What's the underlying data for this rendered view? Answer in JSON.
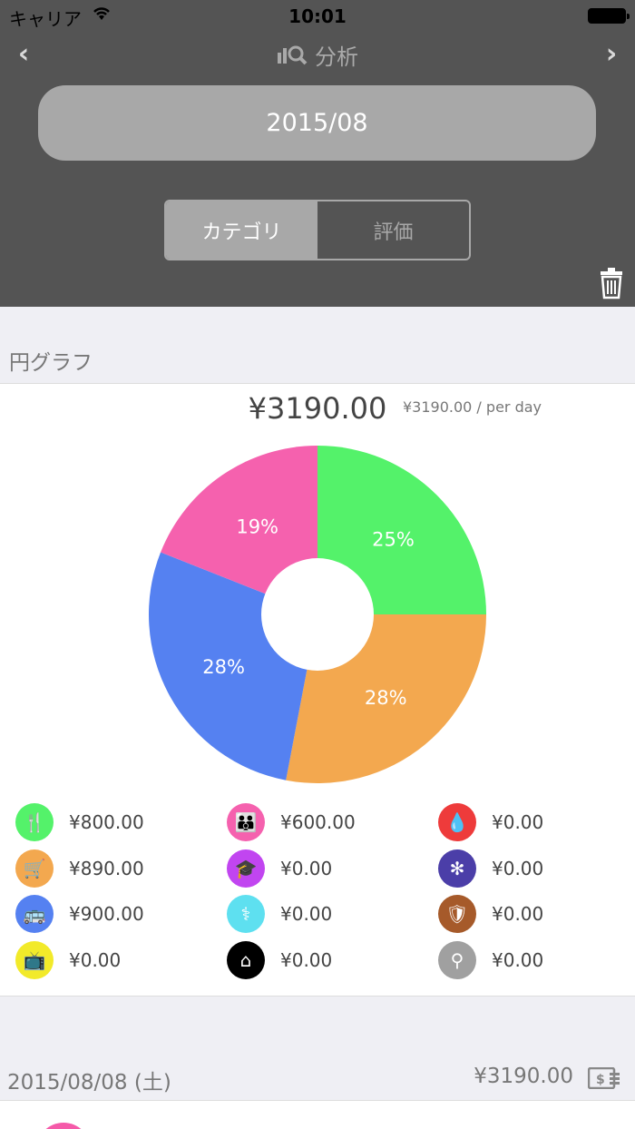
{
  "status": {
    "carrier": "キャリア",
    "time": "10:01"
  },
  "nav": {
    "title": "分析",
    "back": "‹",
    "forward": "›"
  },
  "month": "2015/08",
  "segments": [
    "カテゴリ",
    "評価"
  ],
  "section_title": "円グラフ",
  "summary": {
    "total": "¥3190.00",
    "per_day": "¥3190.00 / per day"
  },
  "chart_data": {
    "type": "pie",
    "donut": true,
    "slices": [
      {
        "label": "25%",
        "value": 25,
        "color": "#54f26a"
      },
      {
        "label": "28%",
        "value": 28,
        "color": "#f3a84f"
      },
      {
        "label": "28%",
        "value": 28,
        "color": "#5581f1"
      },
      {
        "label": "19%",
        "value": 19,
        "color": "#f561ae"
      }
    ]
  },
  "legend": [
    {
      "icon": "fork-knife-icon",
      "glyph": "🍴",
      "value": "¥800.00",
      "color": "#54f26a"
    },
    {
      "icon": "people-icon",
      "glyph": "👪",
      "value": "¥600.00",
      "color": "#f561ae"
    },
    {
      "icon": "drop-icon",
      "glyph": "💧",
      "value": "¥0.00",
      "color": "#ee3b3b"
    },
    {
      "icon": "cart-icon",
      "glyph": "🛒",
      "value": "¥890.00",
      "color": "#f3a84f"
    },
    {
      "icon": "graduation-cap-icon",
      "glyph": "🎓",
      "value": "¥0.00",
      "color": "#c145f0"
    },
    {
      "icon": "network-icon",
      "glyph": "✻",
      "value": "¥0.00",
      "color": "#4b3ea8"
    },
    {
      "icon": "bus-icon",
      "glyph": "🚌",
      "value": "¥900.00",
      "color": "#5581f1"
    },
    {
      "icon": "stethoscope-icon",
      "glyph": "⚕",
      "value": "¥0.00",
      "color": "#5ee0f0"
    },
    {
      "icon": "shield-icon",
      "glyph": "🛡",
      "value": "¥0.00",
      "color": "#a65a2a"
    },
    {
      "icon": "tv-icon",
      "glyph": "📺",
      "value": "¥0.00",
      "color": "#f2ea2a"
    },
    {
      "icon": "home-icon",
      "glyph": "⌂",
      "value": "¥0.00",
      "color": "#000000"
    },
    {
      "icon": "location-pin-icon",
      "glyph": "⚲",
      "value": "¥0.00",
      "color": "#a0a0a0"
    }
  ],
  "day": {
    "date": "2015/08/08 (土)",
    "total": "¥3190.00"
  }
}
